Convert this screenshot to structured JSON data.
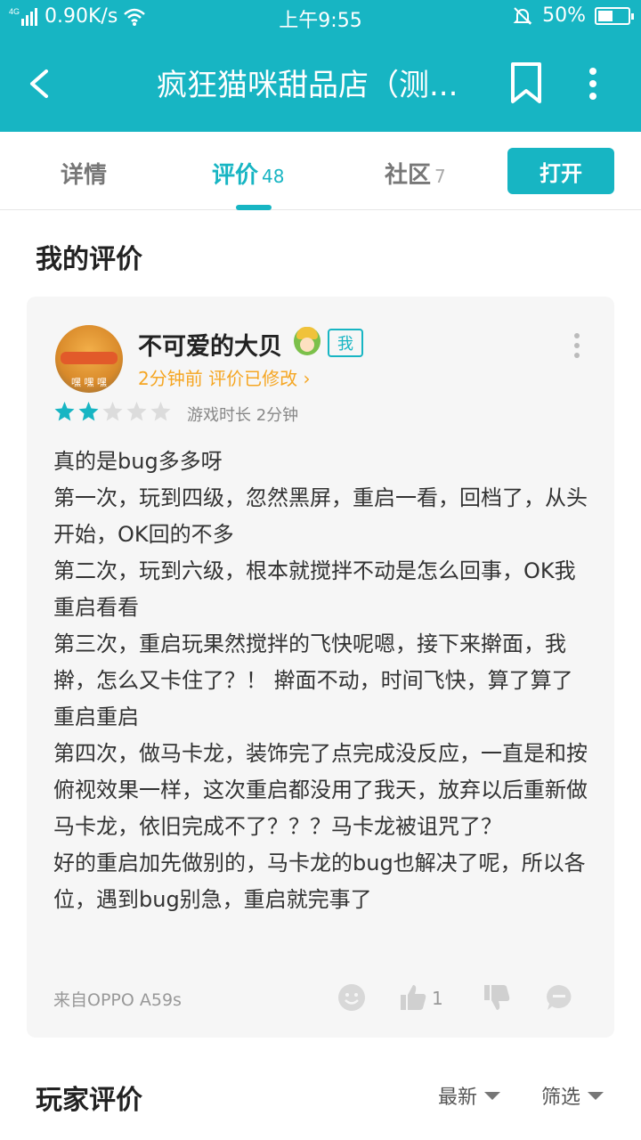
{
  "status_bar": {
    "network": "4G",
    "speed": "0.90K/s",
    "time": "上午9:55",
    "battery_percent": "50%",
    "battery_level": 0.5
  },
  "app_bar": {
    "title": "疯狂猫咪甜品店（测..."
  },
  "tabs": [
    {
      "label": "详情",
      "count": ""
    },
    {
      "label": "评价",
      "count": "48"
    },
    {
      "label": "社区",
      "count": "7"
    }
  ],
  "active_tab": 1,
  "open_button": "打开",
  "my_review_title": "我的评价",
  "review": {
    "username": "不可爱的大贝",
    "avatar_caption": "嘿 嘿 嘿",
    "me_tag": "我",
    "meta": "2分钟前 评价已修改 ›",
    "rating": 2,
    "rating_max": 5,
    "playtime": "游戏时长 2分钟",
    "body_lines": [
      "真的是bug多多呀",
      "第一次，玩到四级，忽然黑屏，重启一看，回档了，从头开始，OK回的不多",
      "第二次，玩到六级，根本就搅拌不动是怎么回事，OK我重启看看",
      "第三次，重启玩果然搅拌的飞快呢嗯，接下来擀面，我擀，怎么又卡住了？！ 擀面不动，时间飞快，算了算了重启重启",
      "第四次，做马卡龙，装饰完了点完成没反应，一直是和按俯视效果一样，这次重启都没用了我天，放弃以后重新做马卡龙，依旧完成不了？？？马卡龙被诅咒了？",
      "好的重启加先做别的，马卡龙的bug也解决了呢，所以各位，遇到bug别急，重启就完事了"
    ],
    "source": "来自OPPO A59s",
    "like_count": "1"
  },
  "player_reviews_title": "玩家评价",
  "sort_label": "最新",
  "filter_label": "筛选",
  "colors": {
    "primary": "#17b5c3",
    "accent_orange": "#f5a623",
    "star_empty": "#dcdcdc",
    "card_bg": "#f6f6f6"
  },
  "icons": [
    "back-arrow-icon",
    "bookmark-icon",
    "more-vertical-icon",
    "wifi-icon",
    "signal-icon",
    "mute-bell-icon",
    "emoji-icon",
    "thumb-up-icon",
    "thumb-down-icon",
    "comment-icon",
    "triangle-down-icon"
  ]
}
